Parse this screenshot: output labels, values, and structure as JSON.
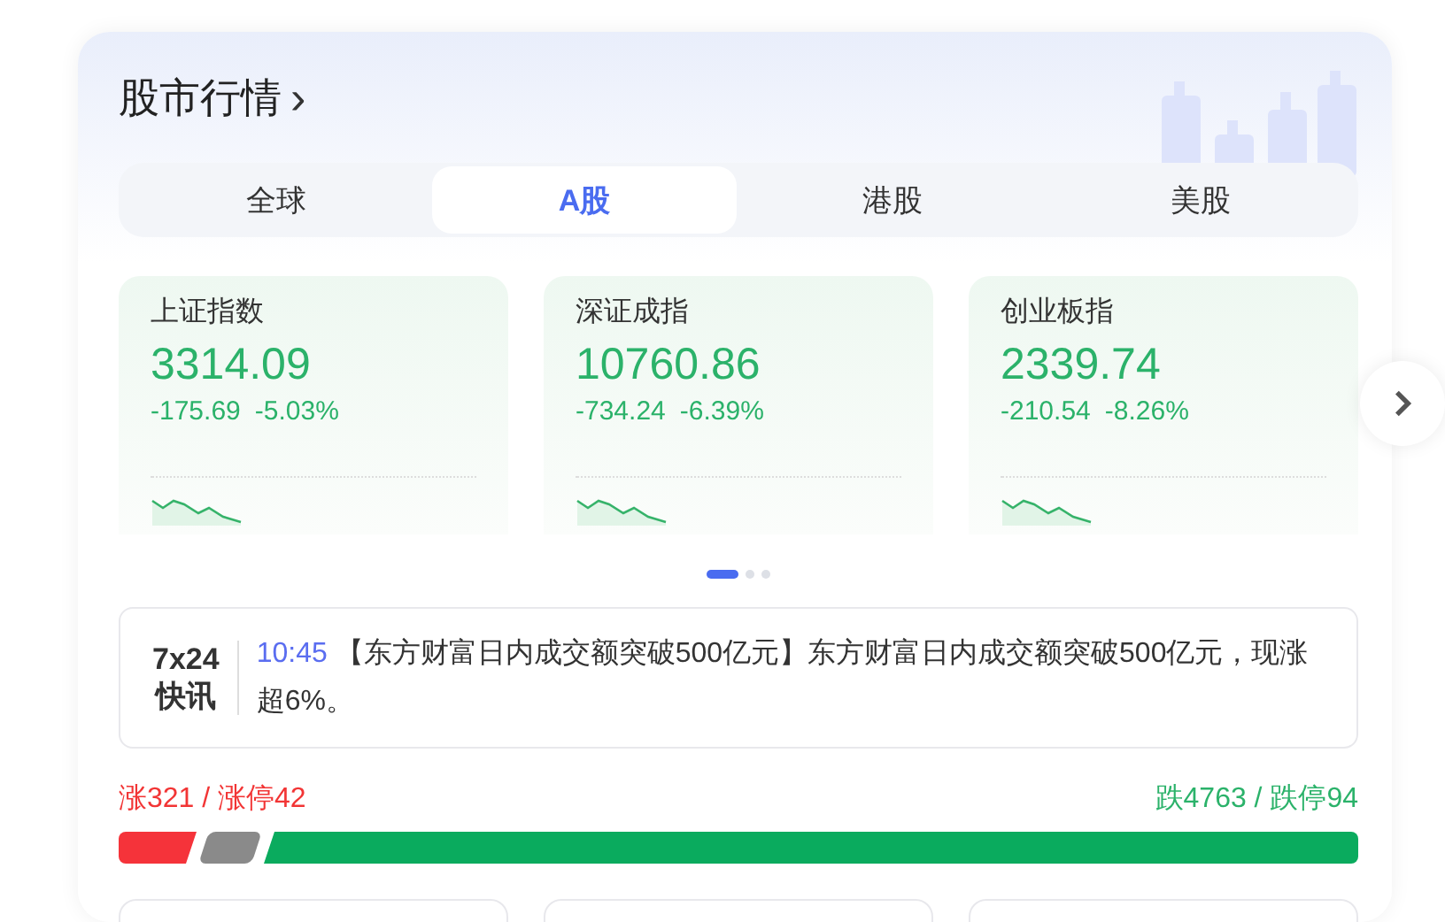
{
  "header": {
    "title": "股市行情",
    "chevron": "›"
  },
  "tabs": [
    {
      "label": "全球",
      "selected": false
    },
    {
      "label": "A股",
      "selected": true
    },
    {
      "label": "港股",
      "selected": false
    },
    {
      "label": "美股",
      "selected": false
    }
  ],
  "indices": [
    {
      "name": "上证指数",
      "value": "3314.09",
      "change": "-175.69",
      "percent": "-5.03%",
      "kind": "fall"
    },
    {
      "name": "深证成指",
      "value": "10760.86",
      "change": "-734.24",
      "percent": "-6.39%",
      "kind": "fall"
    },
    {
      "name": "创业板指",
      "value": "2339.74",
      "change": "-210.54",
      "percent": "-8.26%",
      "kind": "fall"
    }
  ],
  "pager": [
    {
      "selected": true
    },
    {
      "selected": false
    },
    {
      "selected": false
    }
  ],
  "news": {
    "brand_top": "7x24",
    "brand_bottom": "快讯",
    "time": "10:45",
    "text": "【东方财富日内成交额突破500亿元】东方财富日内成交额突破500亿元，现涨超6%。"
  },
  "breadth": {
    "up_label": "涨321 / 涨停42",
    "down_label": "跌4763 / 跌停94",
    "segments": [
      {
        "kind": "up"
      },
      {
        "kind": "flat"
      },
      {
        "kind": "down"
      }
    ]
  }
}
